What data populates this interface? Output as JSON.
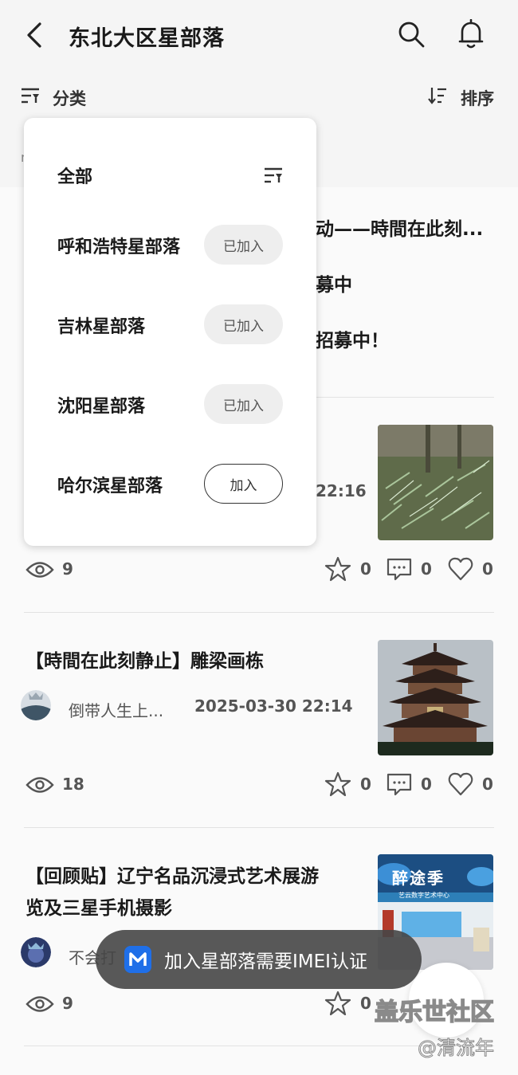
{
  "header": {
    "title": "东北大区星部落",
    "filter_label": "分类",
    "sort_label": "排序",
    "faded_text": "n"
  },
  "background_posts": {
    "post1_line1": "动——時間在此刻...",
    "post1_line2": "募中",
    "post1_line3": "招募中！",
    "post2_time": "22:16",
    "post2_views": "9",
    "post2_stars": "0",
    "post2_comments": "0",
    "post2_likes": "0"
  },
  "posts": [
    {
      "title": "【時間在此刻静止】雕梁画栋",
      "author": "倒带人生上...",
      "date": "2025-03-30 22:14",
      "views": "18",
      "stars": "0",
      "comments": "0",
      "likes": "0"
    },
    {
      "title_line1": "【回顾贴】辽宁名品沉浸式艺术展游",
      "title_line2": "览及三星手机摄影",
      "author": "不会打",
      "views": "9",
      "stars": "0",
      "thumb_sign": "醉途季",
      "thumb_sub": "艺云数字艺术中心"
    }
  ],
  "dropdown": {
    "all_label": "全部",
    "items": [
      {
        "name": "呼和浩特星部落",
        "button": "已加入"
      },
      {
        "name": "吉林星部落",
        "button": "已加入"
      },
      {
        "name": "沈阳星部落",
        "button": "已加入"
      },
      {
        "name": "哈尔滨星部落",
        "button": "加入"
      }
    ]
  },
  "toast": {
    "text": "加入星部落需要IMEI认证"
  },
  "watermark": {
    "line1": "盖乐世社区",
    "line2": "@清流年"
  },
  "colors": {
    "toast_icon": "#1f6fe8",
    "button_joined_bg": "#eeeeee"
  }
}
